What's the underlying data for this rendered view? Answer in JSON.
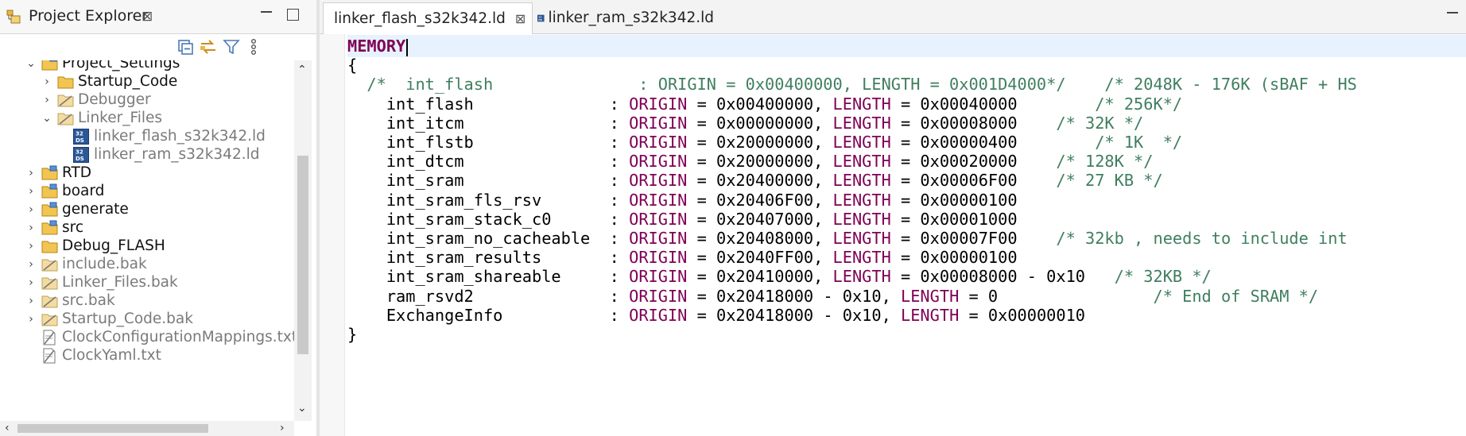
{
  "project_explorer": {
    "title": "Project Explorer",
    "close_glyph": "⊠",
    "tree": [
      {
        "label": "Project_Settings",
        "level": 1,
        "expanded": true,
        "icon": "project-folder-icon",
        "dim": false
      },
      {
        "label": "Startup_Code",
        "level": 2,
        "expanded": false,
        "icon": "folder-icon",
        "dim": false
      },
      {
        "label": "Debugger",
        "level": 2,
        "expanded": false,
        "icon": "excluded-folder-icon",
        "dim": true
      },
      {
        "label": "Linker_Files",
        "level": 2,
        "expanded": true,
        "icon": "excluded-folder-icon",
        "dim": true
      },
      {
        "label": "linker_flash_s32k342.ld",
        "level": 3,
        "icon": "ld-file-icon",
        "dim": true
      },
      {
        "label": "linker_ram_s32k342.ld",
        "level": 3,
        "icon": "ld-file-icon",
        "dim": true
      },
      {
        "label": "RTD",
        "level": 1,
        "expanded": false,
        "icon": "project-folder-icon",
        "dim": false
      },
      {
        "label": "board",
        "level": 1,
        "expanded": false,
        "icon": "project-folder-icon",
        "dim": false
      },
      {
        "label": "generate",
        "level": 1,
        "expanded": false,
        "icon": "project-folder-icon",
        "dim": false
      },
      {
        "label": "src",
        "level": 1,
        "expanded": false,
        "icon": "project-folder-icon",
        "dim": false
      },
      {
        "label": "Debug_FLASH",
        "level": 1,
        "expanded": false,
        "icon": "folder-icon",
        "dim": false
      },
      {
        "label": "include.bak",
        "level": 1,
        "expanded": false,
        "icon": "excluded-folder-icon",
        "dim": true
      },
      {
        "label": "Linker_Files.bak",
        "level": 1,
        "expanded": false,
        "icon": "excluded-folder-icon",
        "dim": true
      },
      {
        "label": "src.bak",
        "level": 1,
        "expanded": false,
        "icon": "excluded-folder-icon",
        "dim": true
      },
      {
        "label": "Startup_Code.bak",
        "level": 1,
        "expanded": false,
        "icon": "excluded-folder-icon",
        "dim": true
      },
      {
        "label": "ClockConfigurationMappings.txt",
        "level": 1,
        "icon": "excluded-text-file-icon",
        "dim": true
      },
      {
        "label": "ClockYaml.txt",
        "level": 1,
        "icon": "excluded-text-file-icon",
        "dim": true
      }
    ]
  },
  "editor": {
    "tabs": [
      {
        "label": "linker_flash_s32k342.ld",
        "active": true,
        "close_glyph": "⊠"
      },
      {
        "label": "linker_ram_s32k342.ld",
        "active": false
      }
    ],
    "lines": [
      [
        {
          "t": "MEMORY",
          "c": "kw"
        },
        {
          "cursor": true
        }
      ],
      [
        {
          "t": "{"
        }
      ],
      [
        {
          "t": "  /*  int_flash               : ORIGIN = 0x00400000, LENGTH = 0x001D4000*/    /* 2048K - 176K (sBAF + HS",
          "c": "cm"
        }
      ],
      [
        {
          "t": "    int_flash              : "
        },
        {
          "t": "ORIGIN",
          "c": "ky"
        },
        {
          "t": " = 0x00400000, "
        },
        {
          "t": "LENGTH",
          "c": "ky"
        },
        {
          "t": " = 0x00040000        "
        },
        {
          "t": "/* 256K*/",
          "c": "cm"
        }
      ],
      [
        {
          "t": "    int_itcm               : "
        },
        {
          "t": "ORIGIN",
          "c": "ky"
        },
        {
          "t": " = 0x00000000, "
        },
        {
          "t": "LENGTH",
          "c": "ky"
        },
        {
          "t": " = 0x00008000    "
        },
        {
          "t": "/* 32K */",
          "c": "cm"
        }
      ],
      [
        {
          "t": "    int_flstb              : "
        },
        {
          "t": "ORIGIN",
          "c": "ky"
        },
        {
          "t": " = 0x20000000, "
        },
        {
          "t": "LENGTH",
          "c": "ky"
        },
        {
          "t": " = 0x00000400        "
        },
        {
          "t": "/* 1K  */",
          "c": "cm"
        }
      ],
      [
        {
          "t": "    int_dtcm               : "
        },
        {
          "t": "ORIGIN",
          "c": "ky"
        },
        {
          "t": " = 0x20000000, "
        },
        {
          "t": "LENGTH",
          "c": "ky"
        },
        {
          "t": " = 0x00020000    "
        },
        {
          "t": "/* 128K */",
          "c": "cm"
        }
      ],
      [
        {
          "t": "    int_sram               : "
        },
        {
          "t": "ORIGIN",
          "c": "ky"
        },
        {
          "t": " = 0x20400000, "
        },
        {
          "t": "LENGTH",
          "c": "ky"
        },
        {
          "t": " = 0x00006F00    "
        },
        {
          "t": "/* 27 KB */",
          "c": "cm"
        }
      ],
      [
        {
          "t": "    int_sram_fls_rsv       : "
        },
        {
          "t": "ORIGIN",
          "c": "ky"
        },
        {
          "t": " = 0x20406F00, "
        },
        {
          "t": "LENGTH",
          "c": "ky"
        },
        {
          "t": " = 0x00000100"
        }
      ],
      [
        {
          "t": "    int_sram_stack_c0      : "
        },
        {
          "t": "ORIGIN",
          "c": "ky"
        },
        {
          "t": " = 0x20407000, "
        },
        {
          "t": "LENGTH",
          "c": "ky"
        },
        {
          "t": " = 0x00001000"
        }
      ],
      [
        {
          "t": "    int_sram_no_cacheable  : "
        },
        {
          "t": "ORIGIN",
          "c": "ky"
        },
        {
          "t": " = 0x20408000, "
        },
        {
          "t": "LENGTH",
          "c": "ky"
        },
        {
          "t": " = 0x00007F00    "
        },
        {
          "t": "/* 32kb , needs to include int",
          "c": "cm"
        }
      ],
      [
        {
          "t": "    int_sram_results       : "
        },
        {
          "t": "ORIGIN",
          "c": "ky"
        },
        {
          "t": " = 0x2040FF00, "
        },
        {
          "t": "LENGTH",
          "c": "ky"
        },
        {
          "t": " = 0x00000100"
        }
      ],
      [
        {
          "t": "    int_sram_shareable     : "
        },
        {
          "t": "ORIGIN",
          "c": "ky"
        },
        {
          "t": " = 0x20410000, "
        },
        {
          "t": "LENGTH",
          "c": "ky"
        },
        {
          "t": " = 0x00008000 - 0x10   "
        },
        {
          "t": "/* 32KB */",
          "c": "cm"
        }
      ],
      [
        {
          "t": "    ram_rsvd2              : "
        },
        {
          "t": "ORIGIN",
          "c": "ky"
        },
        {
          "t": " = 0x20418000 - 0x10, "
        },
        {
          "t": "LENGTH",
          "c": "ky"
        },
        {
          "t": " = 0                "
        },
        {
          "t": "/* End of SRAM */",
          "c": "cm"
        }
      ],
      [
        {
          "t": "    ExchangeInfo           : "
        },
        {
          "t": "ORIGIN",
          "c": "ky"
        },
        {
          "t": " = 0x20418000 - 0x10, "
        },
        {
          "t": "LENGTH",
          "c": "ky"
        },
        {
          "t": " = 0x00000010"
        }
      ],
      [
        {
          "t": "}"
        }
      ]
    ]
  },
  "colors": {
    "keyword": "#7f0055",
    "comment": "#3f7f5f",
    "current_line": "#e8f2fe",
    "project_folder": "#e8b84a",
    "excluded": "#7a7a7a"
  }
}
